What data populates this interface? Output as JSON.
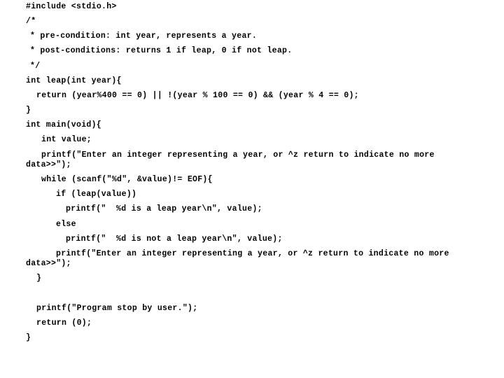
{
  "document": {
    "language": "C",
    "lines": [
      {
        "indent": 0,
        "text": "#include <stdio.h>"
      },
      {
        "indent": 0,
        "text": "/*"
      },
      {
        "indent": 1,
        "text": "* pre-condition: int year, represents a year."
      },
      {
        "indent": 1,
        "text": "* post-conditions: returns 1 if leap, 0 if not leap."
      },
      {
        "indent": 1,
        "text": "*/"
      },
      {
        "indent": 0,
        "text": "int leap(int year){"
      },
      {
        "indent": 2,
        "text": "return (year%400 == 0) || !(year % 100 == 0) && (year % 4 == 0);"
      },
      {
        "indent": 0,
        "text": "}"
      },
      {
        "indent": 0,
        "text": "int main(void){"
      },
      {
        "indent": 3,
        "text": "int value;"
      },
      {
        "indent": 3,
        "text": "printf(\"Enter an integer representing a year, or ^z return to indicate no more",
        "cont": "data>>\");"
      },
      {
        "indent": 3,
        "text": "while (scanf(\"%d\", &value)!= EOF){"
      },
      {
        "indent": 6,
        "text": "if (leap(value))"
      },
      {
        "indent": 8,
        "text": "printf(\"  %d is a leap year\\n\", value);"
      },
      {
        "indent": 6,
        "text": "else"
      },
      {
        "indent": 8,
        "text": "printf(\"  %d is not a leap year\\n\", value);"
      },
      {
        "indent": 6,
        "text": "printf(\"Enter an integer representing a year, or ^z return to indicate no more",
        "cont": "data>>\");"
      },
      {
        "indent": 2,
        "text": "}"
      },
      {
        "indent": 2,
        "text": "printf(\"Program stop by user.\");"
      },
      {
        "indent": 2,
        "text": "return (0);"
      },
      {
        "indent": 0,
        "text": "}"
      }
    ]
  }
}
